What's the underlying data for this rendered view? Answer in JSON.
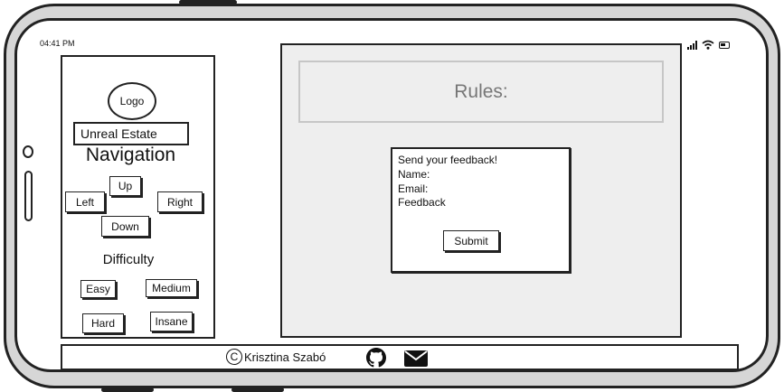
{
  "status_bar": {
    "time": "04:41 PM",
    "icons": [
      "signal-icon",
      "wifi-icon",
      "battery-icon"
    ]
  },
  "sidebar": {
    "logo": "Logo",
    "brand": "Unreal Estate",
    "navigation_title": "Navigation",
    "nav_buttons": {
      "up": "Up",
      "left": "Left",
      "right": "Right",
      "down": "Down"
    },
    "difficulty_title": "Difficulty",
    "difficulty_buttons": {
      "easy": "Easy",
      "medium": "Medium",
      "hard": "Hard",
      "insane": "Insane"
    }
  },
  "main": {
    "rules_title": "Rules:",
    "feedback": {
      "heading": "Send your feedback!",
      "name_label": "Name:",
      "email_label": "Email:",
      "feedback_label": "Feedback",
      "submit_label": "Submit"
    }
  },
  "footer": {
    "copyright_symbol": "C",
    "author": "Krisztina Szabó",
    "icons": [
      "github-icon",
      "email-icon"
    ]
  }
}
